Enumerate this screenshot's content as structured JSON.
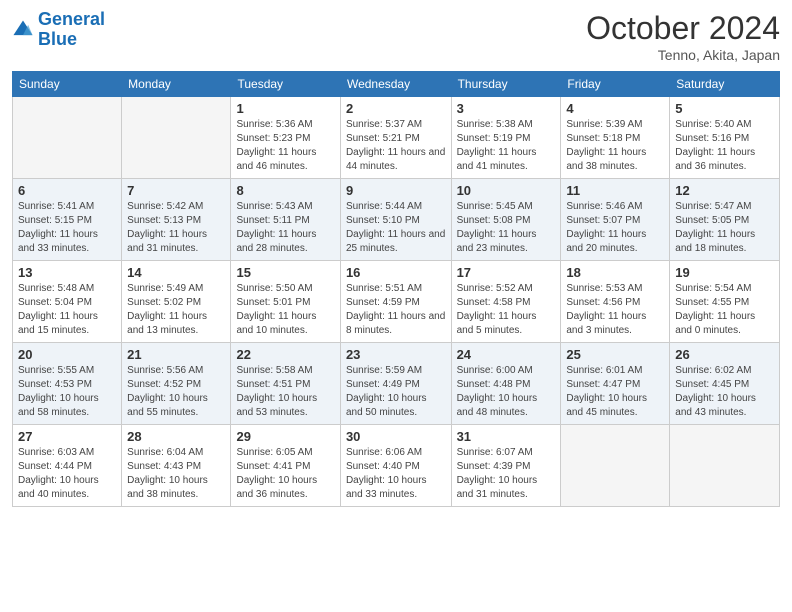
{
  "header": {
    "logo_line1": "General",
    "logo_line2": "Blue",
    "month_title": "October 2024",
    "subtitle": "Tenno, Akita, Japan"
  },
  "weekdays": [
    "Sunday",
    "Monday",
    "Tuesday",
    "Wednesday",
    "Thursday",
    "Friday",
    "Saturday"
  ],
  "weeks": [
    [
      {
        "day": "",
        "sunrise": "",
        "sunset": "",
        "daylight": "",
        "empty": true
      },
      {
        "day": "",
        "sunrise": "",
        "sunset": "",
        "daylight": "",
        "empty": true
      },
      {
        "day": "1",
        "sunrise": "Sunrise: 5:36 AM",
        "sunset": "Sunset: 5:23 PM",
        "daylight": "Daylight: 11 hours and 46 minutes.",
        "empty": false
      },
      {
        "day": "2",
        "sunrise": "Sunrise: 5:37 AM",
        "sunset": "Sunset: 5:21 PM",
        "daylight": "Daylight: 11 hours and 44 minutes.",
        "empty": false
      },
      {
        "day": "3",
        "sunrise": "Sunrise: 5:38 AM",
        "sunset": "Sunset: 5:19 PM",
        "daylight": "Daylight: 11 hours and 41 minutes.",
        "empty": false
      },
      {
        "day": "4",
        "sunrise": "Sunrise: 5:39 AM",
        "sunset": "Sunset: 5:18 PM",
        "daylight": "Daylight: 11 hours and 38 minutes.",
        "empty": false
      },
      {
        "day": "5",
        "sunrise": "Sunrise: 5:40 AM",
        "sunset": "Sunset: 5:16 PM",
        "daylight": "Daylight: 11 hours and 36 minutes.",
        "empty": false
      }
    ],
    [
      {
        "day": "6",
        "sunrise": "Sunrise: 5:41 AM",
        "sunset": "Sunset: 5:15 PM",
        "daylight": "Daylight: 11 hours and 33 minutes.",
        "empty": false
      },
      {
        "day": "7",
        "sunrise": "Sunrise: 5:42 AM",
        "sunset": "Sunset: 5:13 PM",
        "daylight": "Daylight: 11 hours and 31 minutes.",
        "empty": false
      },
      {
        "day": "8",
        "sunrise": "Sunrise: 5:43 AM",
        "sunset": "Sunset: 5:11 PM",
        "daylight": "Daylight: 11 hours and 28 minutes.",
        "empty": false
      },
      {
        "day": "9",
        "sunrise": "Sunrise: 5:44 AM",
        "sunset": "Sunset: 5:10 PM",
        "daylight": "Daylight: 11 hours and 25 minutes.",
        "empty": false
      },
      {
        "day": "10",
        "sunrise": "Sunrise: 5:45 AM",
        "sunset": "Sunset: 5:08 PM",
        "daylight": "Daylight: 11 hours and 23 minutes.",
        "empty": false
      },
      {
        "day": "11",
        "sunrise": "Sunrise: 5:46 AM",
        "sunset": "Sunset: 5:07 PM",
        "daylight": "Daylight: 11 hours and 20 minutes.",
        "empty": false
      },
      {
        "day": "12",
        "sunrise": "Sunrise: 5:47 AM",
        "sunset": "Sunset: 5:05 PM",
        "daylight": "Daylight: 11 hours and 18 minutes.",
        "empty": false
      }
    ],
    [
      {
        "day": "13",
        "sunrise": "Sunrise: 5:48 AM",
        "sunset": "Sunset: 5:04 PM",
        "daylight": "Daylight: 11 hours and 15 minutes.",
        "empty": false
      },
      {
        "day": "14",
        "sunrise": "Sunrise: 5:49 AM",
        "sunset": "Sunset: 5:02 PM",
        "daylight": "Daylight: 11 hours and 13 minutes.",
        "empty": false
      },
      {
        "day": "15",
        "sunrise": "Sunrise: 5:50 AM",
        "sunset": "Sunset: 5:01 PM",
        "daylight": "Daylight: 11 hours and 10 minutes.",
        "empty": false
      },
      {
        "day": "16",
        "sunrise": "Sunrise: 5:51 AM",
        "sunset": "Sunset: 4:59 PM",
        "daylight": "Daylight: 11 hours and 8 minutes.",
        "empty": false
      },
      {
        "day": "17",
        "sunrise": "Sunrise: 5:52 AM",
        "sunset": "Sunset: 4:58 PM",
        "daylight": "Daylight: 11 hours and 5 minutes.",
        "empty": false
      },
      {
        "day": "18",
        "sunrise": "Sunrise: 5:53 AM",
        "sunset": "Sunset: 4:56 PM",
        "daylight": "Daylight: 11 hours and 3 minutes.",
        "empty": false
      },
      {
        "day": "19",
        "sunrise": "Sunrise: 5:54 AM",
        "sunset": "Sunset: 4:55 PM",
        "daylight": "Daylight: 11 hours and 0 minutes.",
        "empty": false
      }
    ],
    [
      {
        "day": "20",
        "sunrise": "Sunrise: 5:55 AM",
        "sunset": "Sunset: 4:53 PM",
        "daylight": "Daylight: 10 hours and 58 minutes.",
        "empty": false
      },
      {
        "day": "21",
        "sunrise": "Sunrise: 5:56 AM",
        "sunset": "Sunset: 4:52 PM",
        "daylight": "Daylight: 10 hours and 55 minutes.",
        "empty": false
      },
      {
        "day": "22",
        "sunrise": "Sunrise: 5:58 AM",
        "sunset": "Sunset: 4:51 PM",
        "daylight": "Daylight: 10 hours and 53 minutes.",
        "empty": false
      },
      {
        "day": "23",
        "sunrise": "Sunrise: 5:59 AM",
        "sunset": "Sunset: 4:49 PM",
        "daylight": "Daylight: 10 hours and 50 minutes.",
        "empty": false
      },
      {
        "day": "24",
        "sunrise": "Sunrise: 6:00 AM",
        "sunset": "Sunset: 4:48 PM",
        "daylight": "Daylight: 10 hours and 48 minutes.",
        "empty": false
      },
      {
        "day": "25",
        "sunrise": "Sunrise: 6:01 AM",
        "sunset": "Sunset: 4:47 PM",
        "daylight": "Daylight: 10 hours and 45 minutes.",
        "empty": false
      },
      {
        "day": "26",
        "sunrise": "Sunrise: 6:02 AM",
        "sunset": "Sunset: 4:45 PM",
        "daylight": "Daylight: 10 hours and 43 minutes.",
        "empty": false
      }
    ],
    [
      {
        "day": "27",
        "sunrise": "Sunrise: 6:03 AM",
        "sunset": "Sunset: 4:44 PM",
        "daylight": "Daylight: 10 hours and 40 minutes.",
        "empty": false
      },
      {
        "day": "28",
        "sunrise": "Sunrise: 6:04 AM",
        "sunset": "Sunset: 4:43 PM",
        "daylight": "Daylight: 10 hours and 38 minutes.",
        "empty": false
      },
      {
        "day": "29",
        "sunrise": "Sunrise: 6:05 AM",
        "sunset": "Sunset: 4:41 PM",
        "daylight": "Daylight: 10 hours and 36 minutes.",
        "empty": false
      },
      {
        "day": "30",
        "sunrise": "Sunrise: 6:06 AM",
        "sunset": "Sunset: 4:40 PM",
        "daylight": "Daylight: 10 hours and 33 minutes.",
        "empty": false
      },
      {
        "day": "31",
        "sunrise": "Sunrise: 6:07 AM",
        "sunset": "Sunset: 4:39 PM",
        "daylight": "Daylight: 10 hours and 31 minutes.",
        "empty": false
      },
      {
        "day": "",
        "sunrise": "",
        "sunset": "",
        "daylight": "",
        "empty": true
      },
      {
        "day": "",
        "sunrise": "",
        "sunset": "",
        "daylight": "",
        "empty": true
      }
    ]
  ]
}
